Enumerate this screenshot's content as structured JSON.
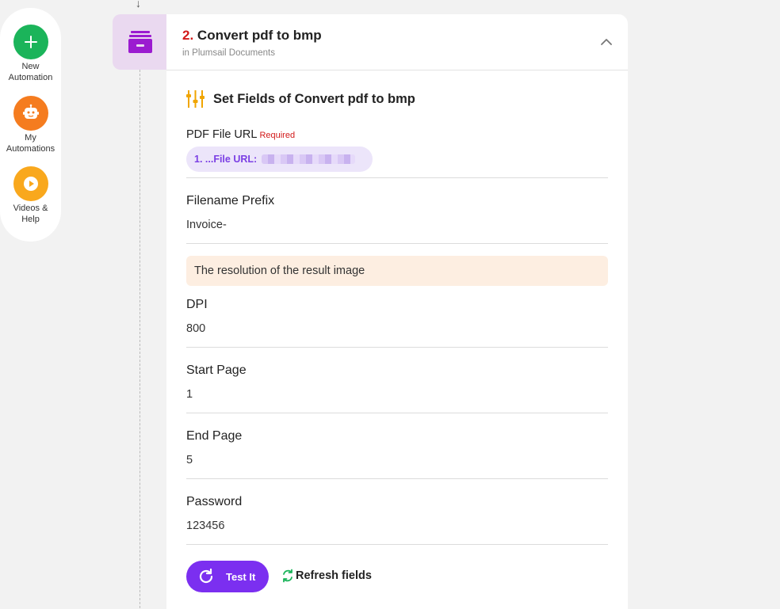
{
  "sidebar": {
    "items": [
      {
        "label_line1": "New",
        "label_line2": "Automation",
        "icon": "plus-icon",
        "color": "#1bb45a"
      },
      {
        "label_line1": "My",
        "label_line2": "Automations",
        "icon": "robot-icon",
        "color": "#f57c1f"
      },
      {
        "label_line1": "Videos &",
        "label_line2": "Help",
        "icon": "play-icon",
        "color": "#f9a81d"
      }
    ]
  },
  "flow": {
    "arrow_glyph": "↓"
  },
  "step": {
    "number": "2.",
    "title": "Convert pdf to bmp",
    "subtitle": "in Plumsail Documents",
    "icon": "archive-drawer-icon",
    "accent": "#9b1bd0"
  },
  "section": {
    "title": "Set Fields of Convert pdf to bmp",
    "icon": "sliders-icon"
  },
  "fields": {
    "pdf_url": {
      "label": "PDF File URL",
      "required": "Required",
      "token": "1. ...File URL:"
    },
    "prefix": {
      "label": "Filename Prefix",
      "value": "Invoice-"
    },
    "hint": "The resolution of the result image",
    "dpi": {
      "label": "DPI",
      "value": "800"
    },
    "start_page": {
      "label": "Start Page",
      "value": "1"
    },
    "end_page": {
      "label": "End Page",
      "value": "5"
    },
    "password": {
      "label": "Password",
      "value": "123456"
    }
  },
  "actions": {
    "test_label": "Test It",
    "refresh_label": "Refresh fields"
  },
  "colors": {
    "primary": "#7b2ff0",
    "required": "#d21a1a",
    "hint_bg": "#fdeee1"
  }
}
